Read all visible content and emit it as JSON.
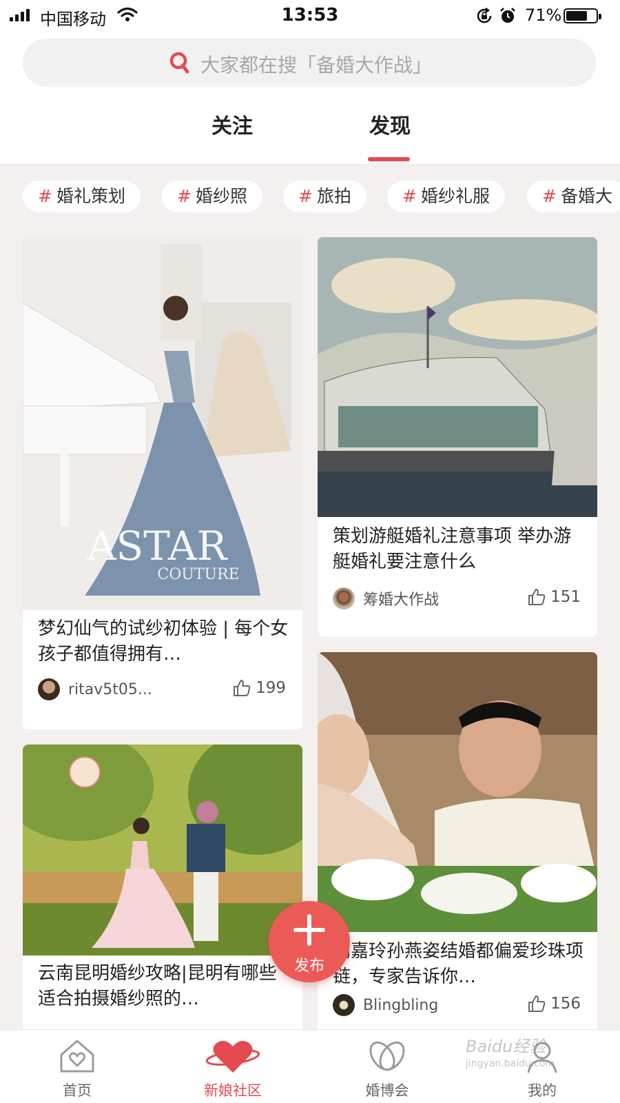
{
  "status_bar": {
    "carrier": "中国移动",
    "time": "13:53",
    "battery_percent": "71%",
    "battery_level": 0.71,
    "icons": [
      "signal-icon",
      "wifi-icon",
      "rotation-lock-icon",
      "alarm-icon",
      "battery-icon"
    ]
  },
  "search": {
    "placeholder": "大家都在搜「备婚大作战」",
    "icon": "search-icon"
  },
  "tabs": {
    "follow": "关注",
    "discover": "发现",
    "active": "discover"
  },
  "topics": [
    {
      "hash": "#",
      "label": "婚礼策划"
    },
    {
      "hash": "#",
      "label": "婚纱照"
    },
    {
      "hash": "#",
      "label": "旅拍"
    },
    {
      "hash": "#",
      "label": "婚纱礼服"
    },
    {
      "hash": "#",
      "label": "备婚大"
    }
  ],
  "feed": [
    {
      "title": "梦幻仙气的试纱初体验 | 每个女孩子都值得拥有…",
      "image_text": "ASTAR",
      "image_subtext": "COUTURE",
      "author": "ritav5t05...",
      "likes": "199"
    },
    {
      "title": "策划游艇婚礼注意事项 举办游艇婚礼要注意什么",
      "author": "筹婚大作战",
      "likes": "151"
    },
    {
      "title": "云南昆明婚纱攻略|昆明有哪些适合拍摄婚纱照的…"
    },
    {
      "title": "刘嘉玲孙燕姿结婚都偏爱珍珠项链，专家告诉你…",
      "author": "Blingbling",
      "likes": "156"
    }
  ],
  "fab": {
    "label": "发布",
    "icon": "plus-icon"
  },
  "tab_bar": {
    "items": [
      {
        "label": "首页",
        "icon": "home-heart-icon"
      },
      {
        "label": "新娘社区",
        "icon": "heart-planet-icon"
      },
      {
        "label": "婚博会",
        "icon": "rings-icon"
      },
      {
        "label": "我的",
        "icon": "profile-icon"
      }
    ],
    "active_index": 1
  },
  "watermark": {
    "text": "Baidu经验",
    "subtext": "jingyan.baidu.com"
  },
  "colors": {
    "accent": "#e44a4f",
    "fab": "#ec5a58",
    "background": "#f3f0ef"
  }
}
